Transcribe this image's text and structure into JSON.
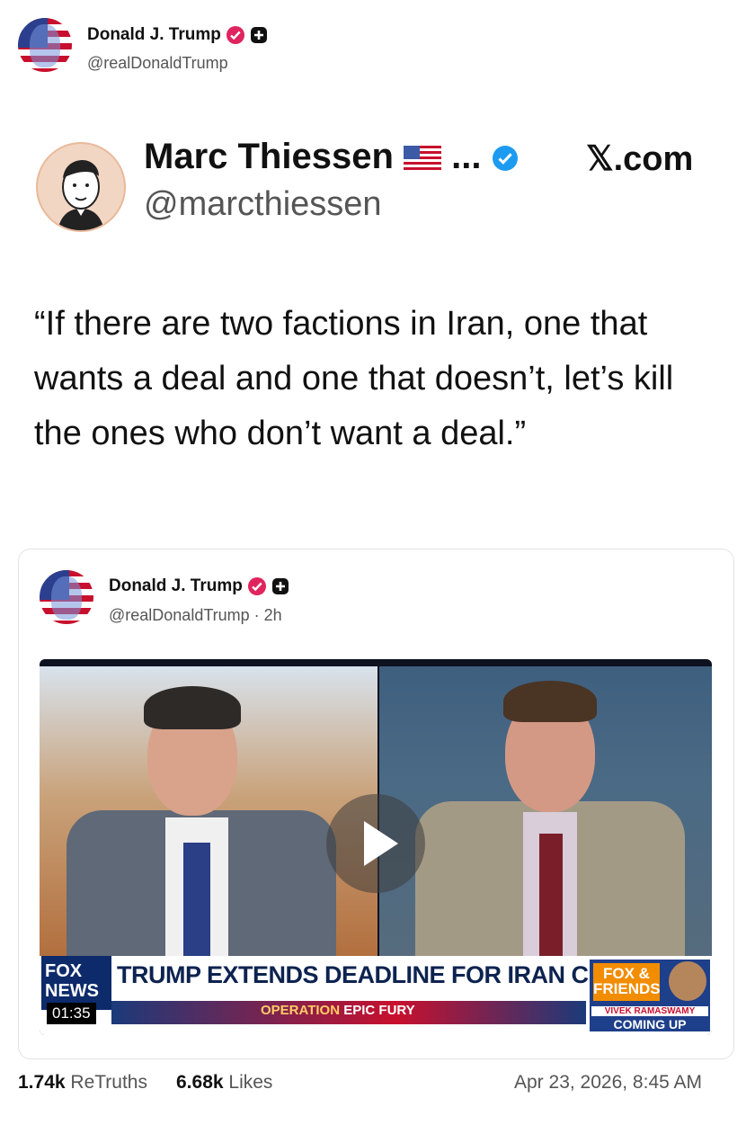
{
  "header": {
    "name": "Donald J. Trump",
    "handle": "@realDonaldTrump"
  },
  "quoted_post": {
    "name": "Marc Thiessen",
    "name_suffix": "...",
    "handle": "@marcthiessen",
    "source": "𝕏.com",
    "text": "“If there are two factions in Iran, one that wants a deal and one that doesn’t, let’s kill the ones who don’t want a deal.”"
  },
  "embedded_post": {
    "name": "Donald J. Trump",
    "handle": "@realDonaldTrump · 2h",
    "video": {
      "headline": "TRUMP EXTENDS DEADLINE FOR IRAN CEASEFIRE",
      "network_logo": "FOX NEWS",
      "duration": "01:35",
      "operation_label": "OPERATION",
      "operation_name": "EPIC FURY",
      "show_logo": "FOX & FRIENDS",
      "guest_name": "VIVEK RAMASWAMY",
      "coming_up": "COMING UP"
    }
  },
  "footer": {
    "retruths_count": "1.74k",
    "retruths_label": "ReTruths",
    "likes_count": "6.68k",
    "likes_label": "Likes",
    "timestamp": "Apr 23, 2026, 8:45 AM"
  },
  "colors": {
    "verified_badge": "#e0245e",
    "x_verified_badge": "#1d9bf0",
    "fox_blue": "#0d2a6b",
    "ticker_red": "#c8102e"
  },
  "icons": [
    "verified-badge-icon",
    "plus-badge-icon",
    "x-verified-check-icon",
    "us-flag-icon",
    "play-icon"
  ]
}
